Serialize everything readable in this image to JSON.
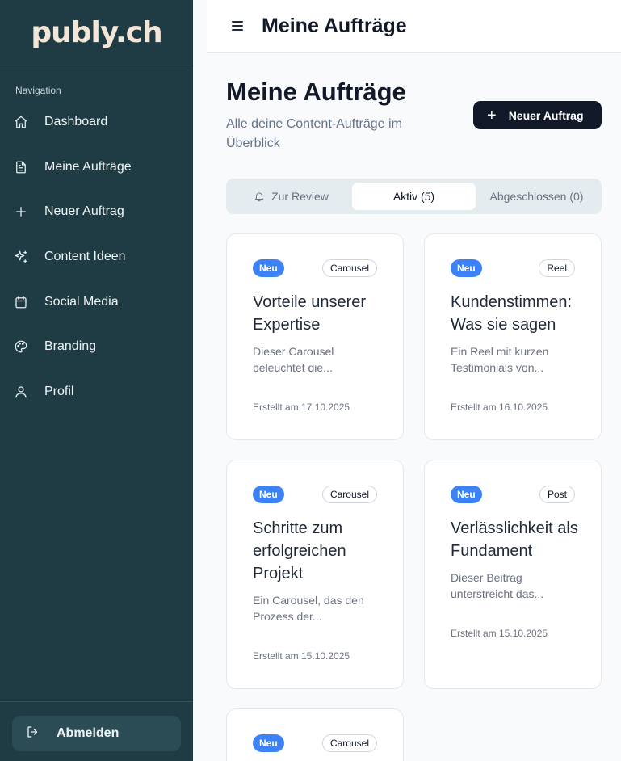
{
  "sidebar": {
    "logo": "publy.ch",
    "nav_label": "Navigation",
    "items": [
      {
        "label": "Dashboard",
        "icon": "home-icon"
      },
      {
        "label": "Meine Aufträge",
        "icon": "file-text-icon"
      },
      {
        "label": "Neuer Auftrag",
        "icon": "plus-icon"
      },
      {
        "label": "Content Ideen",
        "icon": "sparkles-icon"
      },
      {
        "label": "Social Media",
        "icon": "calendar-icon"
      },
      {
        "label": "Branding",
        "icon": "palette-icon"
      },
      {
        "label": "Profil",
        "icon": "user-icon"
      }
    ],
    "logout_label": "Abmelden"
  },
  "header": {
    "title": "Meine Aufträge"
  },
  "main": {
    "title": "Meine Aufträge",
    "subtitle": "Alle deine Content-Aufträge im Überblick",
    "new_button_label": "Neuer Auftrag",
    "tabs": [
      {
        "label": "Zur Review",
        "active": false
      },
      {
        "label": "Aktiv (5)",
        "active": true
      },
      {
        "label": "Abgeschlossen (0)",
        "active": false
      }
    ],
    "cards": [
      {
        "status": "Neu",
        "type": "Carousel",
        "title": "Vorteile unserer Expertise",
        "description": "Dieser Carousel beleuchtet die...",
        "date": "Erstellt am 17.10.2025"
      },
      {
        "status": "Neu",
        "type": "Reel",
        "title": "Kundenstimmen: Was sie sagen",
        "description": "Ein Reel mit kurzen Testimonials von...",
        "date": "Erstellt am 16.10.2025"
      },
      {
        "status": "Neu",
        "type": "Carousel",
        "title": "Schritte zum erfolgreichen Projekt",
        "description": "Ein Carousel, das den Prozess der...",
        "date": "Erstellt am 15.10.2025"
      },
      {
        "status": "Neu",
        "type": "Post",
        "title": "Verlässlichkeit als Fundament",
        "description": "Dieser Beitrag unterstreicht das...",
        "date": "Erstellt am 15.10.2025"
      },
      {
        "status": "Neu",
        "type": "Carousel",
        "title": "",
        "description": "",
        "date": ""
      }
    ]
  },
  "colors": {
    "sidebar_bg": "#1f3c44",
    "primary_button": "#111827",
    "badge_new": "#3b82f6",
    "logo": "#f3e6d8"
  }
}
